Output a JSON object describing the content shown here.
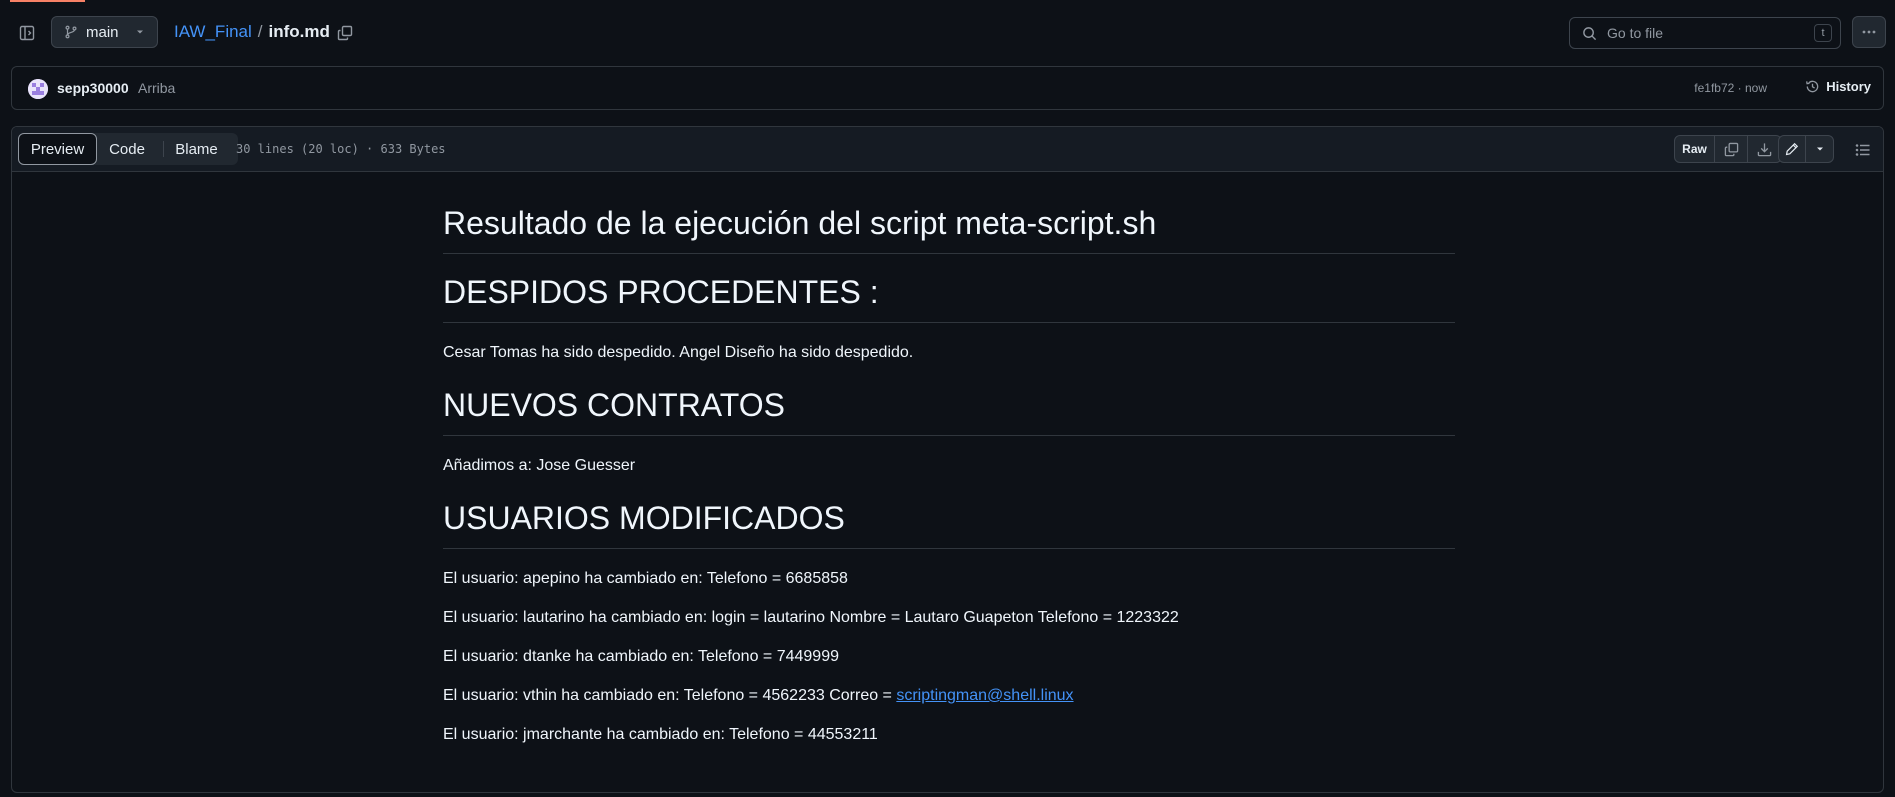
{
  "header": {
    "branch": "main",
    "repo": "IAW_Final",
    "separator": "/",
    "file": "info.md",
    "goto_placeholder": "Go to file",
    "goto_shortcut": "t"
  },
  "commit": {
    "author": "sepp30000",
    "message": "Arriba",
    "meta": "fe1fb72 · now",
    "history_label": "History"
  },
  "file_header": {
    "tabs": [
      "Preview",
      "Code",
      "Blame"
    ],
    "info": "30 lines (20 loc) · 633 Bytes",
    "raw_label": "Raw"
  },
  "content": {
    "title": "Resultado de la ejecución del script meta-script.sh",
    "h_despidos": "DESPIDOS PROCEDENTES :",
    "p_despidos": "Cesar Tomas ha sido despedido. Angel Diseño ha sido despedido.",
    "h_contratos": "NUEVOS CONTRATOS",
    "p_contratos": "Añadimos a: Jose Guesser",
    "h_usuarios": "USUARIOS MODIFICADOS",
    "u1": "El usuario: apepino ha cambiado en: Telefono = 6685858",
    "u2": "El usuario: lautarino ha cambiado en: login = lautarino Nombre = Lautaro Guapeton Telefono = 1223322",
    "u3": "El usuario: dtanke ha cambiado en: Telefono = 7449999",
    "u4_prefix": "El usuario: vthin ha cambiado en: Telefono = 4562233 Correo = ",
    "u4_link": "scriptingman@shell.linux",
    "u5": "El usuario: jmarchante ha cambiado en: Telefono = 44553211"
  },
  "colors": {
    "background": "#0d1117",
    "accent_link": "#4493f8",
    "border": "#30363d"
  }
}
